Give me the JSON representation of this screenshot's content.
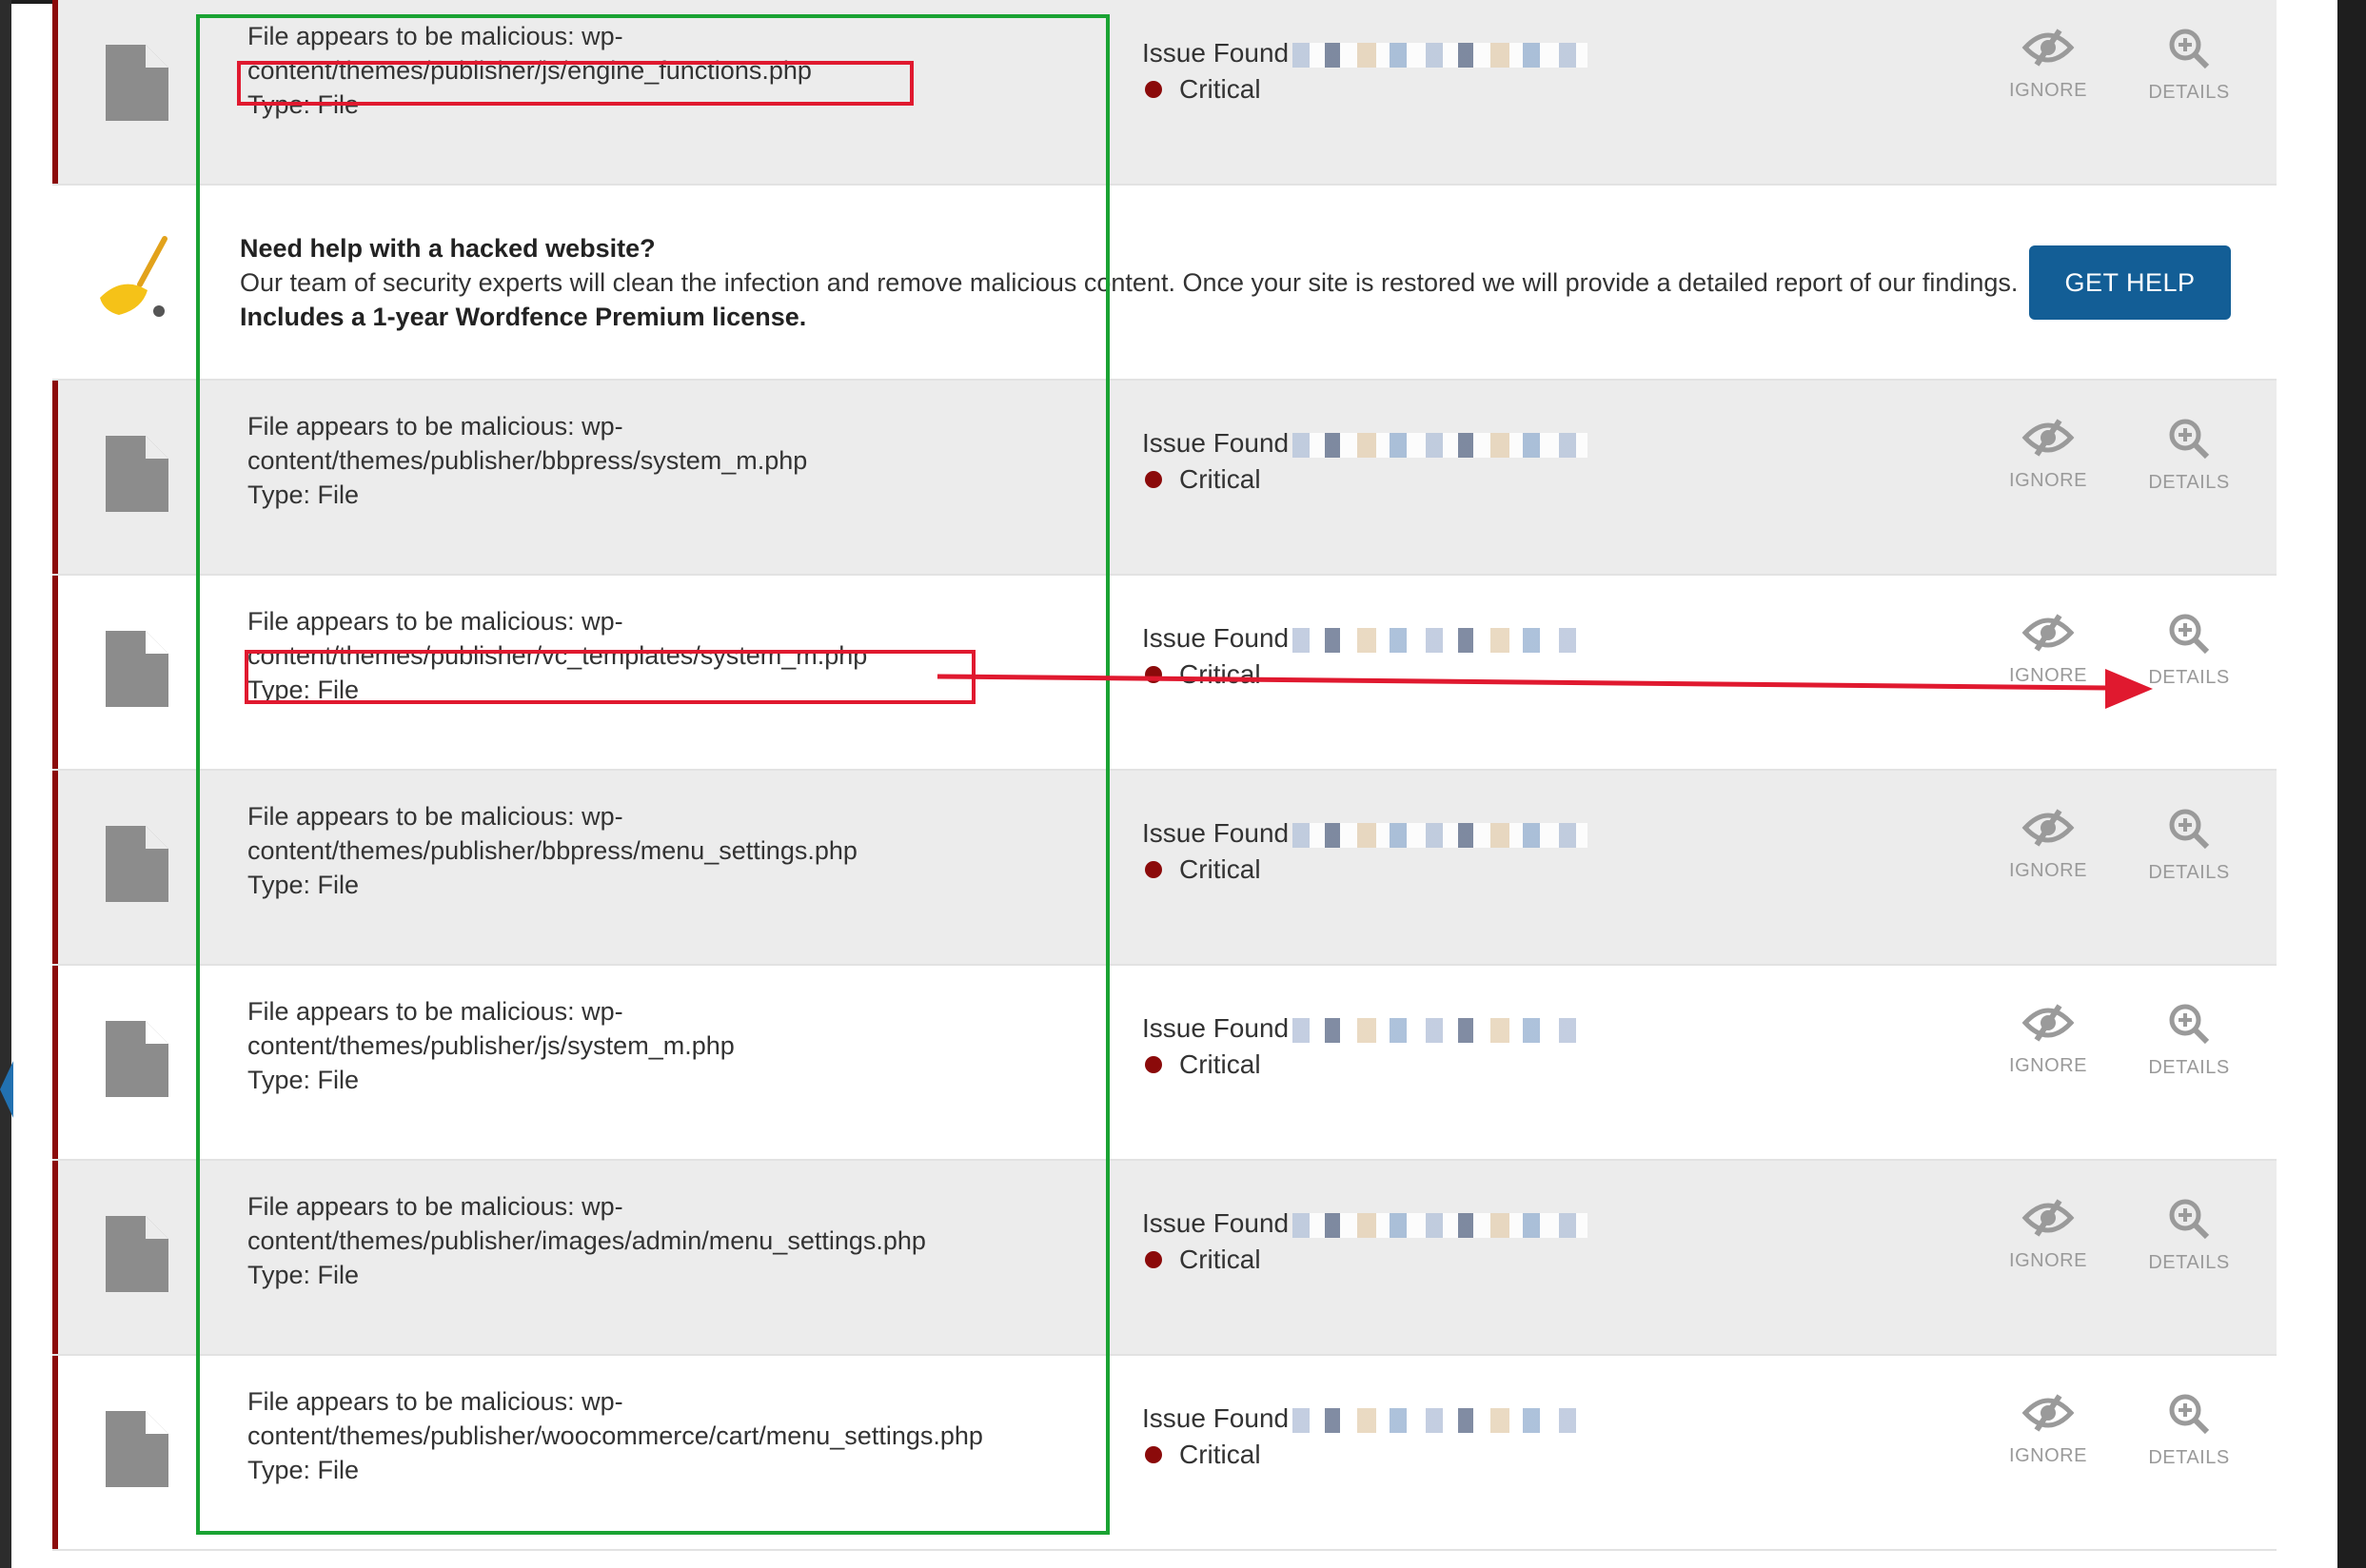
{
  "promo": {
    "title": "Need help with a hacked website?",
    "body": "Our team of security experts will clean the infection and remove malicious content. Once your site is restored we will provide a detailed report of our findings.",
    "bold_tail": "Includes a 1-year Wordfence Premium license.",
    "button_label": "GET HELP",
    "icon": "broom-icon"
  },
  "actions": {
    "ignore_label": "IGNORE",
    "details_label": "DETAILS"
  },
  "colors": {
    "critical": "#8b0a0a",
    "button": "#135e96",
    "highlight_green": "#1aa333",
    "highlight_red": "#e0192f"
  },
  "issues": [
    {
      "line1": "File appears to be malicious: wp-",
      "line2": "content/themes/publisher/js/engine_functions.php",
      "type": "Type: File",
      "status": "Issue Found",
      "severity": "Critical"
    },
    {
      "line1": "File appears to be malicious: wp-",
      "line2": "content/themes/publisher/bbpress/system_m.php",
      "type": "Type: File",
      "status": "Issue Found",
      "severity": "Critical"
    },
    {
      "line1": "File appears to be malicious: wp-",
      "line2": "content/themes/publisher/vc_templates/system_m.php",
      "type": "Type: File",
      "status": "Issue Found",
      "severity": "Critical"
    },
    {
      "line1": "File appears to be malicious: wp-",
      "line2": "content/themes/publisher/bbpress/menu_settings.php",
      "type": "Type: File",
      "status": "Issue Found",
      "severity": "Critical"
    },
    {
      "line1": "File appears to be malicious: wp-",
      "line2": "content/themes/publisher/js/system_m.php",
      "type": "Type: File",
      "status": "Issue Found",
      "severity": "Critical"
    },
    {
      "line1": "File appears to be malicious: wp-",
      "line2": "content/themes/publisher/images/admin/menu_settings.php",
      "type": "Type: File",
      "status": "Issue Found",
      "severity": "Critical"
    },
    {
      "line1": "File appears to be malicious: wp-",
      "line2": "content/themes/publisher/woocommerce/cart/menu_settings.php",
      "type": "Type: File",
      "status": "Issue Found",
      "severity": "Critical"
    }
  ]
}
